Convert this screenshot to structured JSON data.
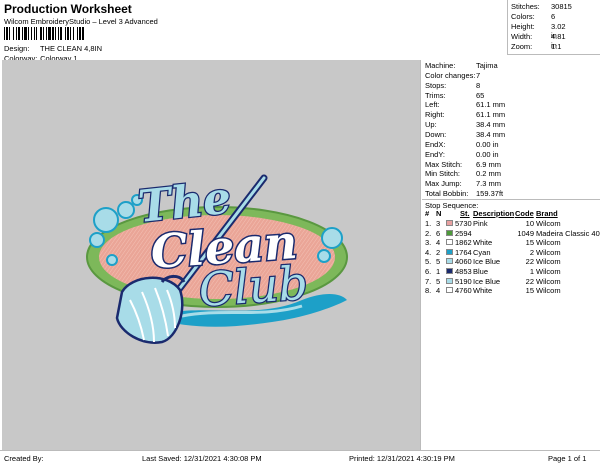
{
  "header": {
    "title": "Production Worksheet",
    "subtitle": "Wilcom EmbroideryStudio – Level 3 Advanced",
    "design_label": "Design:",
    "design_value": "THE CLEAN 4,8IN",
    "colorway_label": "Colorway:",
    "colorway_value": "Colorway 1"
  },
  "stats": [
    {
      "label": "Stitches:",
      "value": "30815"
    },
    {
      "label": "Colors:",
      "value": "6"
    },
    {
      "label": "Height:",
      "value": "3.02 in"
    },
    {
      "label": "Width:",
      "value": "4.81 in"
    },
    {
      "label": "Zoom:",
      "value": "1:1"
    }
  ],
  "info": [
    {
      "label": "Machine:",
      "value": "Tajima"
    },
    {
      "label": "Color changes:",
      "value": "7"
    },
    {
      "label": "Stops:",
      "value": "8"
    },
    {
      "label": "Trims:",
      "value": "65"
    },
    {
      "label": "Left:",
      "value": "61.1 mm"
    },
    {
      "label": "Right:",
      "value": "61.1 mm"
    },
    {
      "label": "Up:",
      "value": "38.4 mm"
    },
    {
      "label": "Down:",
      "value": "38.4 mm"
    },
    {
      "label": "EndX:",
      "value": "0.00 in"
    },
    {
      "label": "EndY:",
      "value": "0.00 in"
    },
    {
      "label": "Max Stitch:",
      "value": "6.9 mm"
    },
    {
      "label": "Min Stitch:",
      "value": "0.2 mm"
    },
    {
      "label": "Max Jump:",
      "value": "7.3 mm"
    },
    {
      "label": "Total Bobbin:",
      "value": "159.37ft"
    }
  ],
  "stop_sequence": {
    "title": "Stop Sequence:",
    "columns": {
      "num": "#",
      "n": "N",
      "st": "St.",
      "description": "Description",
      "code": "Code",
      "brand": "Brand"
    },
    "rows": [
      {
        "num": "1.",
        "n": "3",
        "st": "5730",
        "description": "Pink",
        "code": "10",
        "brand": "Wilcom",
        "color": "#e8a0a0"
      },
      {
        "num": "2.",
        "n": "6",
        "st": "2594",
        "description": "",
        "code": "1049",
        "brand": "Madeira Classic 40",
        "color": "#4d9a3a"
      },
      {
        "num": "3.",
        "n": "4",
        "st": "1862",
        "description": "White",
        "code": "15",
        "brand": "Wilcom",
        "color": "#ffffff"
      },
      {
        "num": "4.",
        "n": "2",
        "st": "1764",
        "description": "Cyan",
        "code": "2",
        "brand": "Wilcom",
        "color": "#1da0c8"
      },
      {
        "num": "5.",
        "n": "5",
        "st": "4060",
        "description": "Ice Blue",
        "code": "22",
        "brand": "Wilcom",
        "color": "#a8dce8"
      },
      {
        "num": "6.",
        "n": "1",
        "st": "4853",
        "description": "Blue",
        "code": "1",
        "brand": "Wilcom",
        "color": "#1a2a6e"
      },
      {
        "num": "7.",
        "n": "5",
        "st": "5190",
        "description": "Ice Blue",
        "code": "22",
        "brand": "Wilcom",
        "color": "#a8dce8"
      },
      {
        "num": "8.",
        "n": "4",
        "st": "4760",
        "description": "White",
        "code": "15",
        "brand": "Wilcom",
        "color": "#ffffff"
      }
    ]
  },
  "design": {
    "line1": "The",
    "line2": "Clean",
    "line3": "Club",
    "colors": {
      "pink": "#e8a89a",
      "green": "#7db85a",
      "cyan": "#1da0c8",
      "ice": "#a8dce8",
      "navy": "#1a2a6e",
      "white": "#ffffff"
    }
  },
  "footer": {
    "created": "Created By:",
    "saved": "Last Saved: 12/31/2021 4:30:08 PM",
    "printed": "Printed: 12/31/2021 4:30:19 PM",
    "page": "Page 1 of 1"
  }
}
